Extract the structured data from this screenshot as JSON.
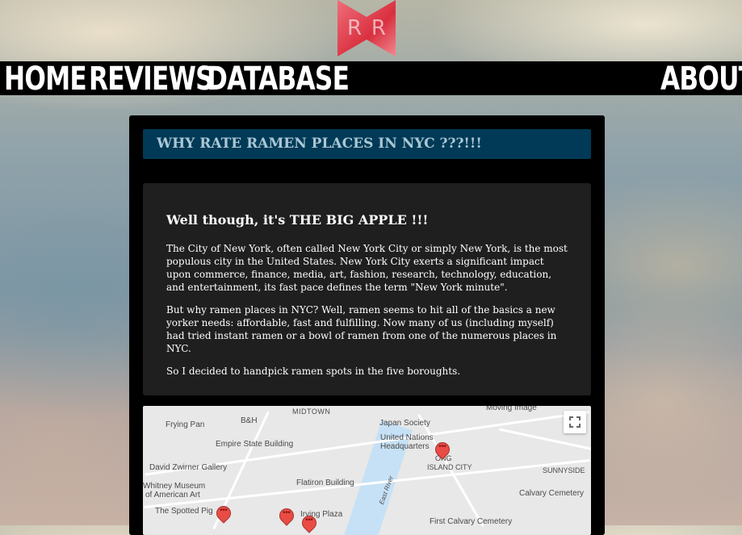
{
  "logo": {
    "left_letter": "R",
    "right_letter": "R",
    "color": "#e23e4d"
  },
  "nav": {
    "home": "HOME",
    "reviews": "REVIEWS",
    "database": "DATABASE",
    "about": "ABOUT"
  },
  "main": {
    "title": "WHY RATE RAMEN PLACES IN NYC ???!!!",
    "heading": "Well though, it's THE BIG APPLE !!!",
    "paragraphs": [
      "The City of New York, often called New York City or simply New York, is the most populous city in the United States. New York City exerts a significant impact upon commerce, finance, media, art, fashion, research, technology, education, and entertainment, its fast pace defines the term \"New York minute\".",
      "But why ramen places in NYC? Well, ramen seems to hit all of the basics a new yorker needs: affordable, fast and fulfilling. Now many of us (including myself) had tried instant ramen or a bowl of ramen from one of the numerous places in NYC.",
      "So I decided to handpick ramen spots in the five boroughts."
    ]
  },
  "map": {
    "labels": {
      "midtown": "MIDTOWN",
      "frying_pan": "Frying Pan",
      "bh": "B&H",
      "japan_society": "Japan Society",
      "moving_image": "Moving Image",
      "united_nations": "United Nations",
      "headquarters": "Headquarters",
      "empire_state": "Empire State Building",
      "long_island_city": "ISLAND CITY",
      "long_prefix": "ONG",
      "sunnyside": "SUNNYSIDE",
      "david_zwirner": "David Zwirner Gallery",
      "whitney1": "Whitney Museum",
      "whitney2": "of American Art",
      "flatiron": "Flatiron Building",
      "east_river": "East River",
      "calvary": "Calvary Cemetery",
      "spotted_pig": "The Spotted Pig",
      "irving_plaza": "Irving Plaza",
      "first_calvary": "First Calvary Cemetery"
    },
    "pin_label": "***",
    "fullscreen_icon": "fullscreen-icon"
  }
}
